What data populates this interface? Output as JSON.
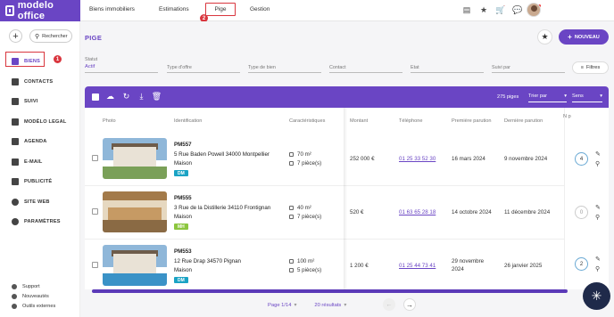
{
  "app": {
    "logo_text": "modelo office"
  },
  "nav": {
    "items": [
      "Biens immobiliers",
      "Estimations",
      "Pige",
      "Gestion"
    ],
    "annotation_2": "2"
  },
  "sidebar": {
    "add_label": "+",
    "search_label": "Rechercher",
    "annotation_1": "1",
    "items": [
      "BIENS",
      "CONTACTS",
      "SUIVI",
      "MODÈLO LEGAL",
      "AGENDA",
      "E-MAIL",
      "PUBLICITÉ",
      "SITE WEB",
      "PARAMÈTRES"
    ],
    "bottom": [
      "Support",
      "Nouveautés",
      "Outils externes"
    ]
  },
  "page": {
    "title": "PIGE",
    "new_button": "NOUVEAU",
    "filters_button": "Filtres"
  },
  "filters": {
    "statut_label": "Statut",
    "statut_value": "Actif",
    "placeholders": [
      "Type d'offre",
      "Type de bien",
      "Contact",
      "Etat",
      "Suivi par"
    ]
  },
  "toolbar": {
    "count": "275 piges",
    "sort_by": "Trier par",
    "sort_dir": "Sens"
  },
  "table": {
    "headers": [
      "Photo",
      "Identification",
      "Caractéristiques",
      "Montant",
      "Téléphone",
      "Première parution",
      "Dernière parution",
      "N p"
    ],
    "rows": [
      {
        "ref": "PM557",
        "address": "5 Rue Baden Powell 34000 Montpellier",
        "type": "Maison",
        "tag": "DM",
        "tag_color": "#1aa3c4",
        "surface": "70 m²",
        "rooms": "7 pièce(s)",
        "amount": "252 000 €",
        "phone": "01 25 33 52 30",
        "first": "16 mars 2024",
        "last": "9 novembre 2024",
        "n": "4"
      },
      {
        "ref": "PM555",
        "address": "3 Rue de la Distillerie 34110 Frontignan",
        "type": "Maison",
        "tag": "MH",
        "tag_color": "#8cc63f",
        "surface": "40 m²",
        "rooms": "7 pièce(s)",
        "amount": "520 €",
        "phone": "01 63 65 28 18",
        "first": "14 octobre 2024",
        "last": "11 décembre 2024",
        "n": "0"
      },
      {
        "ref": "PM553",
        "address": "12 Rue Drap 34570 Pignan",
        "type": "Maison",
        "tag": "DM",
        "tag_color": "#1aa3c4",
        "surface": "100 m²",
        "rooms": "5 pièce(s)",
        "amount": "1 200 €",
        "phone": "01 25 44 73 41",
        "first_l1": "29 novembre",
        "first_l2": "2024",
        "last": "26 janvier 2025",
        "n": "2"
      }
    ]
  },
  "pager": {
    "page": "Page 1/14",
    "per_page": "20 résultats"
  },
  "icons": [
    "pen-icon",
    "search-icon",
    "star-icon",
    "cart-icon",
    "chat-icon",
    "bell-icon",
    "filter-icon"
  ]
}
